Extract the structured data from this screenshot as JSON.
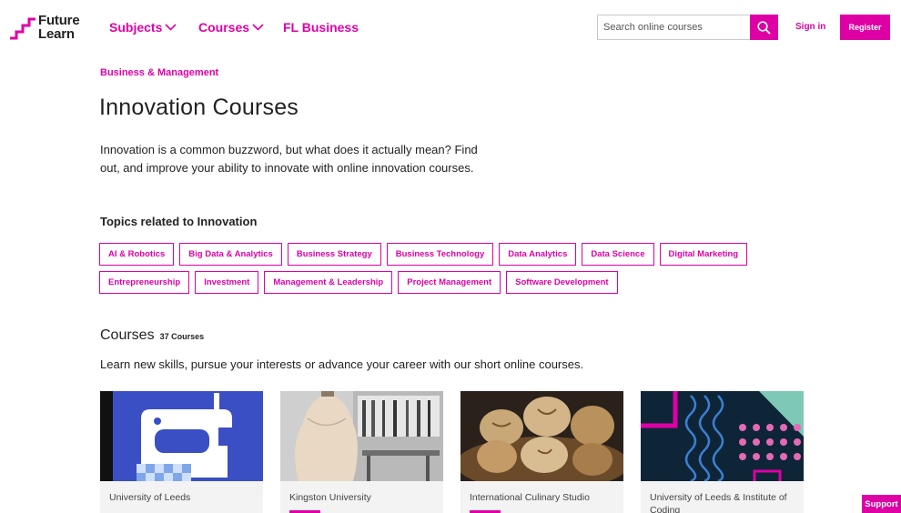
{
  "header": {
    "logo_line1": "Future",
    "logo_line2": "Learn",
    "nav": {
      "subjects": "Subjects",
      "courses": "Courses",
      "business": "FL Business"
    },
    "search_placeholder": "Search online courses",
    "signin": "Sign in",
    "register": "Register"
  },
  "main": {
    "breadcrumb": "Business & Management",
    "title": "Innovation Courses",
    "intro": "Innovation is a common buzzword, but what does it actually mean? Find out, and improve your ability to innovate with online innovation courses.",
    "topics_heading": "Topics related to Innovation",
    "tags_row1": [
      "AI & Robotics",
      "Big Data & Analytics",
      "Business Strategy",
      "Business Technology",
      "Data Analytics",
      "Data Science",
      "Digital Marketing"
    ],
    "tags_row2": [
      "Entrepreneurship",
      "Investment",
      "Management & Leadership",
      "Project Management",
      "Software Development"
    ],
    "courses_title": "Courses",
    "courses_count": "37 Courses",
    "courses_sub": "Learn new skills, pursue your interests or advance your career with our short online courses.",
    "cards": [
      {
        "university": "University of Leeds"
      },
      {
        "university": "Kingston University"
      },
      {
        "university": "International Culinary Studio"
      },
      {
        "university": "University of Leeds & Institute of Coding"
      }
    ]
  },
  "support": "Support",
  "colors": {
    "brand": "#de00a5",
    "text": "#222222",
    "card_bg": "#f3f3f3"
  }
}
